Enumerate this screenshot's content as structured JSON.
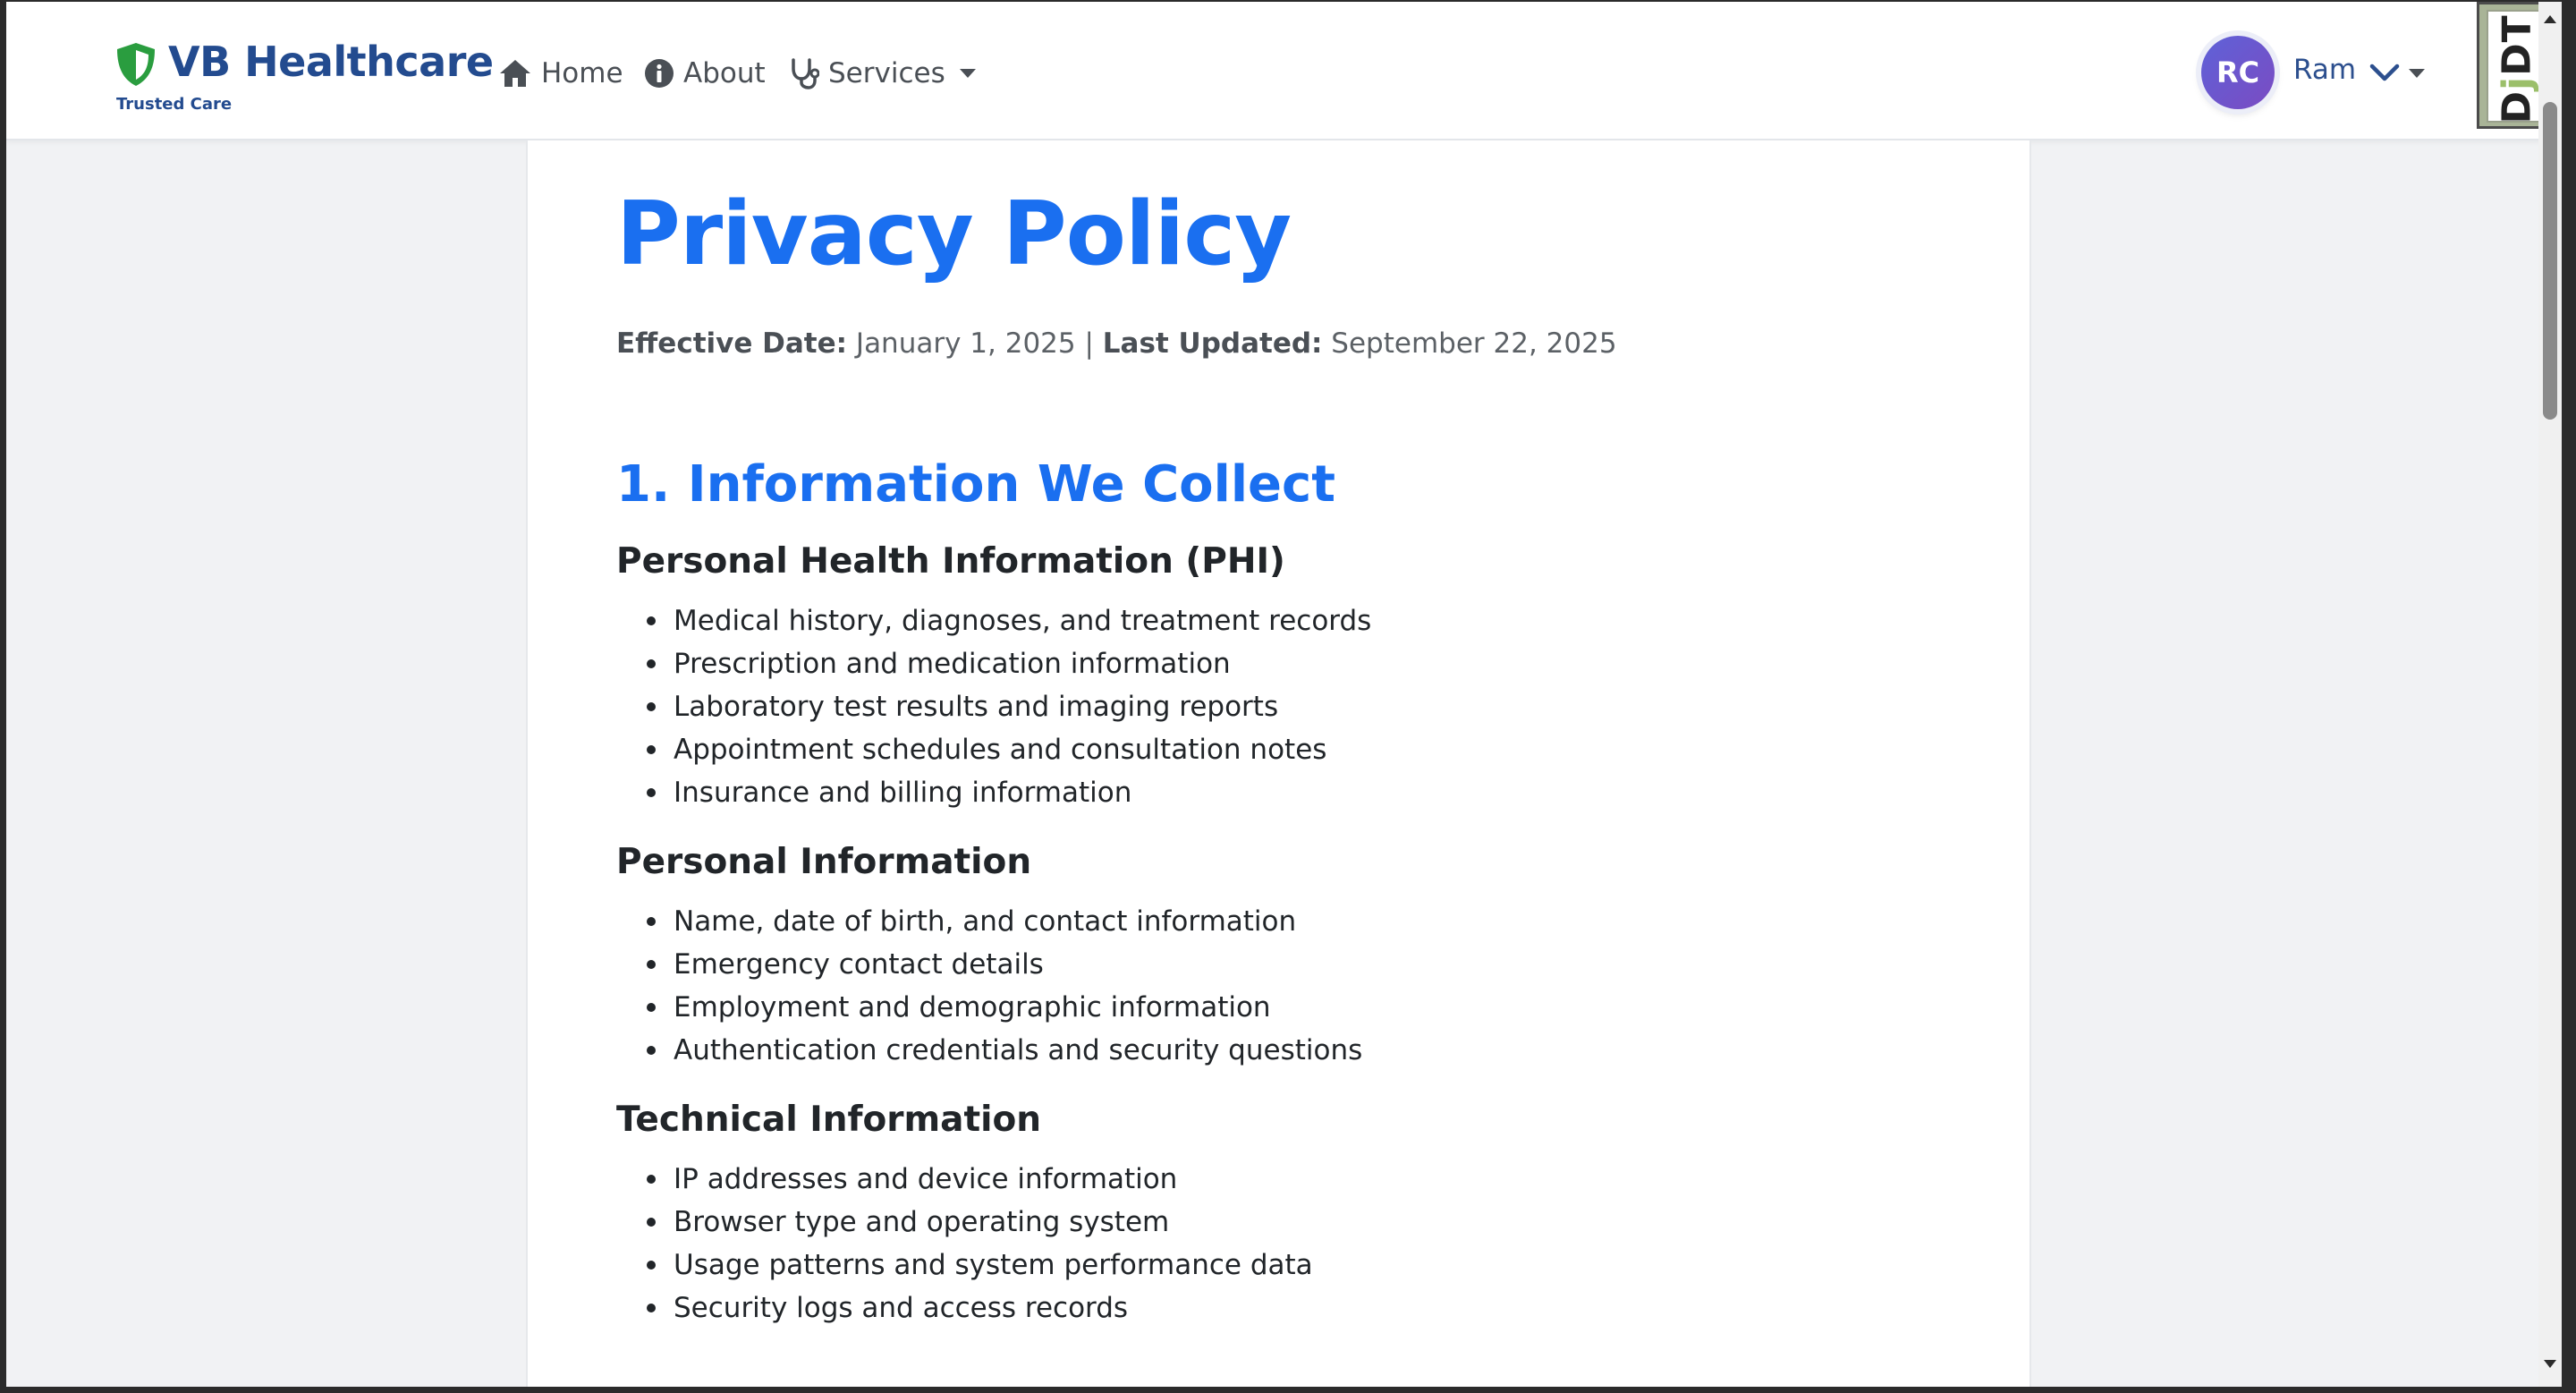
{
  "brand": {
    "name": "VB Healthcare",
    "tagline": "Trusted Care",
    "accent_color": "#2a9d3f",
    "icon": "shield-icon"
  },
  "nav": {
    "items": [
      {
        "label": "Home",
        "icon": "home-icon"
      },
      {
        "label": "About",
        "icon": "info-circle-icon"
      },
      {
        "label": "Services",
        "icon": "stethoscope-icon",
        "dropdown": true
      }
    ]
  },
  "user": {
    "initials": "RC",
    "name": "Ram"
  },
  "debug_toolbar": {
    "label_d": "D",
    "label_j": "j",
    "label_dt": "DT"
  },
  "page": {
    "title": "Privacy Policy",
    "effective_label": "Effective Date:",
    "effective_value": "January 1, 2025",
    "separator": "|",
    "updated_label": "Last Updated:",
    "updated_value": "September 22, 2025",
    "title_color": "#1a6ff0"
  },
  "section": {
    "title": "1. Information We Collect",
    "subsections": [
      {
        "title": "Personal Health Information (PHI)",
        "items": [
          "Medical history, diagnoses, and treatment records",
          "Prescription and medication information",
          "Laboratory test results and imaging reports",
          "Appointment schedules and consultation notes",
          "Insurance and billing information"
        ]
      },
      {
        "title": "Personal Information",
        "items": [
          "Name, date of birth, and contact information",
          "Emergency contact details",
          "Employment and demographic information",
          "Authentication credentials and security questions"
        ]
      },
      {
        "title": "Technical Information",
        "items": [
          "IP addresses and device information",
          "Browser type and operating system",
          "Usage patterns and system performance data",
          "Security logs and access records"
        ]
      }
    ]
  }
}
